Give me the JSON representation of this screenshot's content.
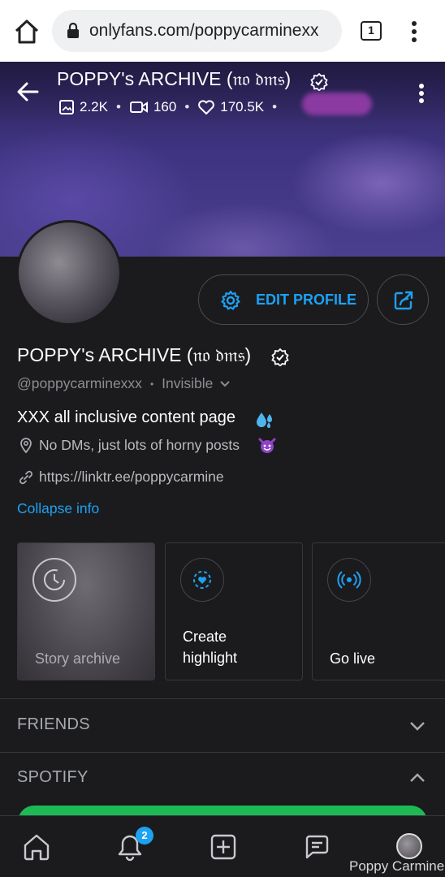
{
  "browser": {
    "url": "onlyfans.com/poppycarminexx",
    "tab_count": "1"
  },
  "cover": {
    "title": "POPPY's ARCHIVE (𝔫𝔬 𝔡𝔪𝔰)",
    "stats": {
      "photos": "2.2K",
      "videos": "160",
      "likes": "170.5K"
    }
  },
  "profile": {
    "edit_label": "EDIT PROFILE",
    "name": "POPPY's ARCHIVE (𝔫𝔬 𝔡𝔪𝔰)",
    "handle": "@poppycarminexxx",
    "status": "Invisible",
    "bio": "XXX all inclusive content page",
    "location": "No DMs, just lots of horny posts",
    "link": "https://linktr.ee/poppycarmine",
    "collapse_label": "Collapse info"
  },
  "cards": {
    "story": "Story archive",
    "highlight": "Create highlight",
    "live": "Go live"
  },
  "sections": {
    "friends": "FRIENDS",
    "spotify": "SPOTIFY"
  },
  "nav": {
    "notifications_badge": "2",
    "user_name": "Poppy Carmine"
  },
  "colors": {
    "accent": "#1da1f2",
    "background": "#1b1b1d",
    "spotify_green": "#1db954"
  },
  "icons": [
    "home-icon",
    "lock-icon",
    "tabs-icon",
    "kebab-menu-icon",
    "back-arrow-icon",
    "verified-icon",
    "image-icon",
    "video-icon",
    "heart-icon",
    "gear-icon",
    "share-icon",
    "droplet-emoji-icon",
    "location-pin-icon",
    "devil-emoji-icon",
    "link-icon",
    "clock-icon",
    "highlight-icon",
    "live-broadcast-icon",
    "chevron-down-icon",
    "chevron-up-icon",
    "bell-icon",
    "add-post-icon",
    "messages-icon"
  ]
}
